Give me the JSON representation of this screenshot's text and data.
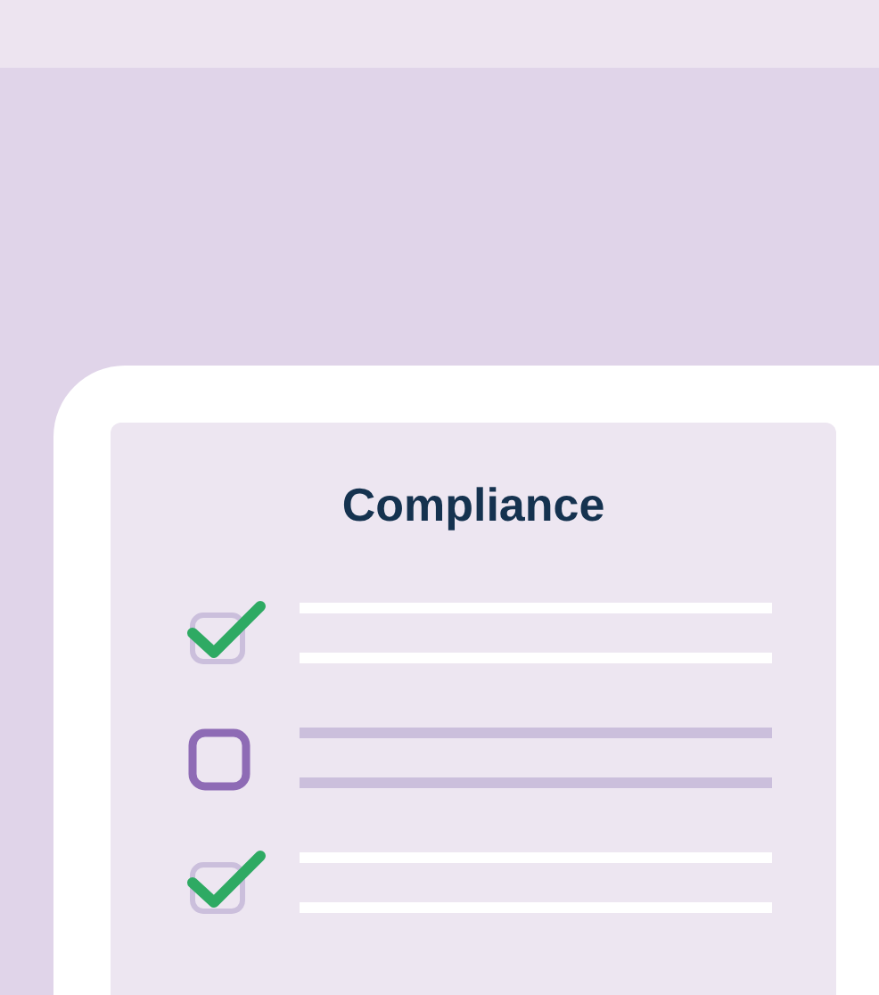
{
  "card": {
    "title": "Compliance",
    "items": [
      {
        "checked": true
      },
      {
        "checked": false
      },
      {
        "checked": true
      }
    ]
  }
}
